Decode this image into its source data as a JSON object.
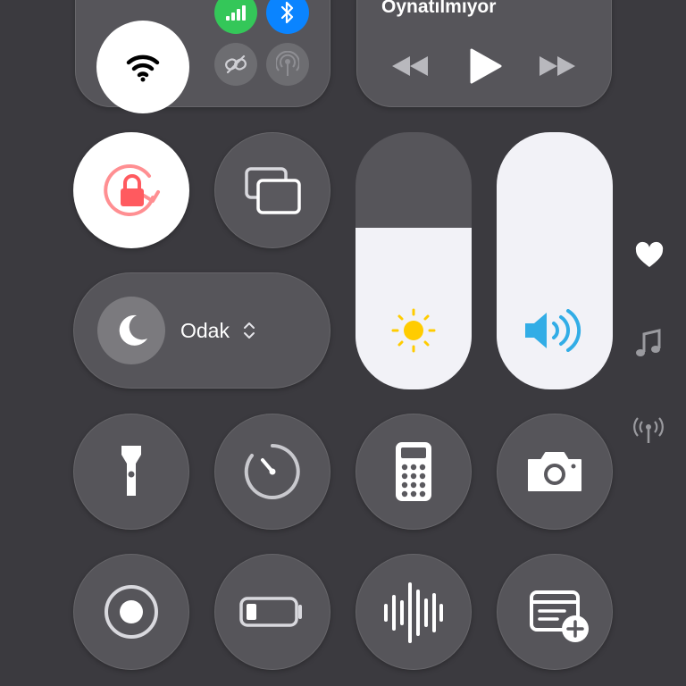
{
  "connectivity": {
    "wifi_icon": "wifi-icon",
    "cellular_icon": "cellular-icon",
    "bluetooth_icon": "bluetooth-icon",
    "airdrop_icon": "link-icon",
    "hotspot_icon": "hotspot-icon",
    "colors": {
      "cellular": "#34c759",
      "bluetooth": "#0a84ff",
      "wifi_bg": "#ffffff"
    }
  },
  "media": {
    "title": "Oynatılmıyor",
    "rewind_icon": "rewind-icon",
    "play_icon": "play-icon",
    "forward_icon": "fast-forward-icon"
  },
  "controls": {
    "orientation_lock_icon": "orientation-lock-icon",
    "screen_mirroring_icon": "screen-mirroring-icon",
    "focus_label": "Odak",
    "focus_icon": "moon-icon"
  },
  "sliders": {
    "brightness": {
      "level": 0.63,
      "icon": "sun-icon",
      "color": "#ffcc00"
    },
    "volume": {
      "level": 1.0,
      "icon": "speaker-icon",
      "color": "#32ade6"
    }
  },
  "side": [
    "heart-icon",
    "music-note-icon",
    "antenna-icon"
  ],
  "grid": [
    "flashlight-icon",
    "timer-icon",
    "calculator-icon",
    "camera-icon",
    "screen-record-icon",
    "low-power-icon",
    "voice-memo-icon",
    "quick-note-icon"
  ],
  "colors": {
    "background": "#3b3a3f",
    "orientation_lock": "#ff5a5f"
  }
}
